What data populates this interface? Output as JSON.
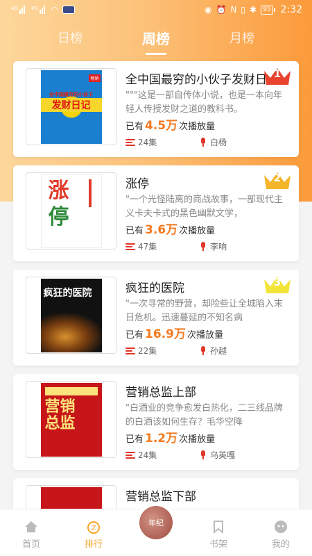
{
  "status_bar": {
    "signal_tag_1": "4G",
    "signal_tag_2": "4G",
    "battery": "95",
    "time": "2:32"
  },
  "tabs": [
    {
      "label": "日榜",
      "active": false
    },
    {
      "label": "周榜",
      "active": true
    },
    {
      "label": "月榜",
      "active": false
    }
  ],
  "books": [
    {
      "rank": "1",
      "crown_color": "#e8432c",
      "title": "全中国最穷的小伙子发财日记",
      "description": "\"\"\"这是一部自传体小说，也是一本向年轻人传授发财之道的教科书。",
      "plays_prefix": "已有",
      "plays_num": "4.5万",
      "plays_suffix": "次播放量",
      "episodes": "24集",
      "narrator": "白杨",
      "cover_title": "发财日记",
      "cover_subtitle": "全中国最穷的小伙子",
      "cover_ribbon": "畅销"
    },
    {
      "rank": "2",
      "crown_color": "#f5b52a",
      "title": "涨停",
      "description": "\"一个光怪陆离的商战故事，一部现代主义卡夫卡式的黑色幽默文学，",
      "plays_prefix": "已有",
      "plays_num": "3.6万",
      "plays_suffix": "次播放量",
      "episodes": "47集",
      "narrator": "李响",
      "cover_title_1": "涨",
      "cover_title_2": "停"
    },
    {
      "rank": "3",
      "crown_color": "#f2e43a",
      "title": "疯狂的医院",
      "description": "\"一次寻常的野营，却险些让全城陷入末日危机。迅速蔓延的不知名病",
      "plays_prefix": "已有",
      "plays_num": "16.9万",
      "plays_suffix": "次播放量",
      "episodes": "22集",
      "narrator": "孙越",
      "cover_title": "疯狂的医院"
    },
    {
      "rank": "",
      "title": "营销总监上部",
      "description": "\"白酒业的竞争愈发白热化，二三线品牌的白酒该如何生存？毛华空降",
      "plays_prefix": "已有",
      "plays_num": "1.2万",
      "plays_suffix": "次播放量",
      "episodes": "24集",
      "narrator": "乌英嘎",
      "cover_title_1": "营销",
      "cover_title_2": "总监"
    },
    {
      "title": "营销总监下部"
    }
  ],
  "tabbar": {
    "home": "首页",
    "rank": "排行",
    "center": "年纪",
    "shelf": "书架",
    "mine": "我的"
  },
  "colors": {
    "accent": "#f47a20",
    "tab_active": "#f5a623",
    "icon_red": "#e0362a"
  }
}
